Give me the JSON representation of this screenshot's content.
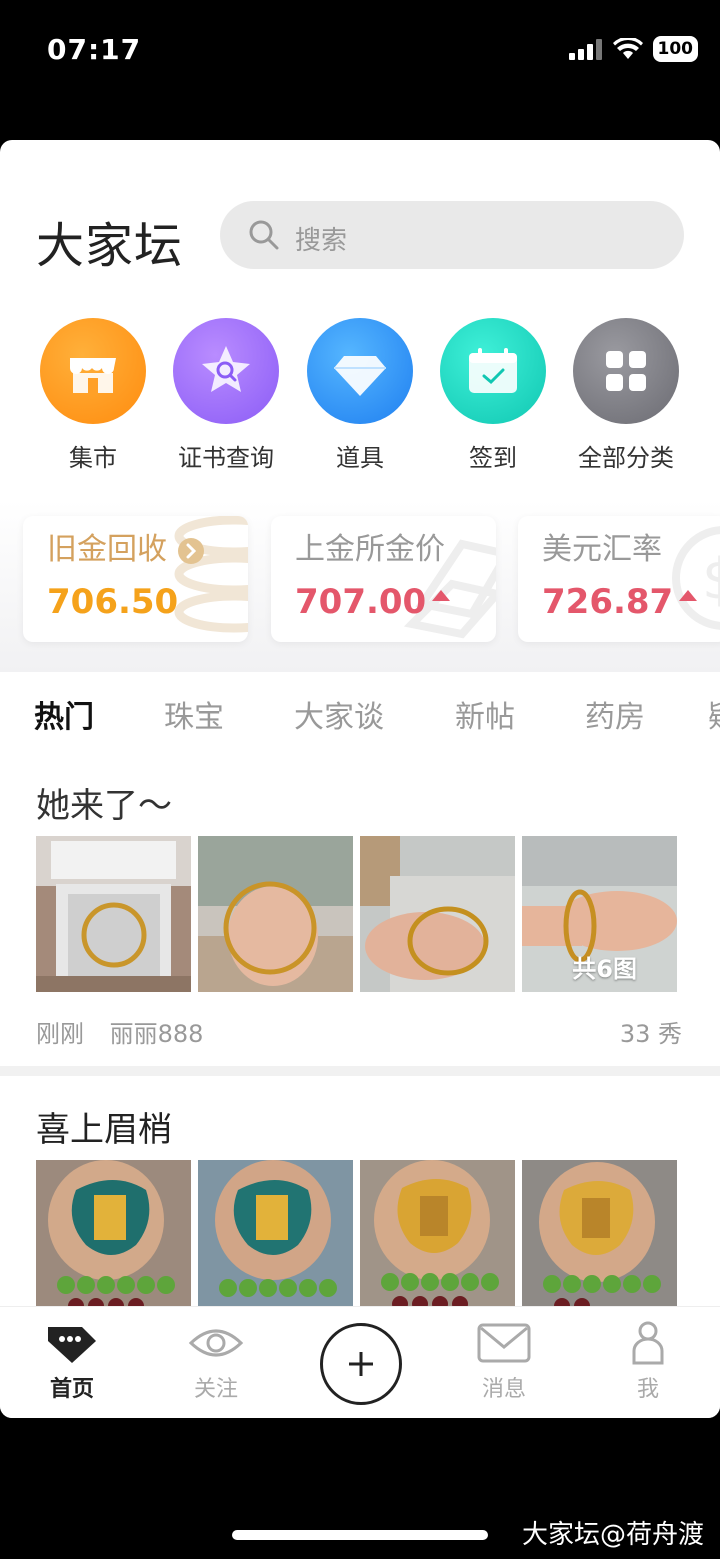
{
  "status": {
    "time": "07:17",
    "battery": "100"
  },
  "header": {
    "logo": "大家坛",
    "search_placeholder": "搜索"
  },
  "categories": [
    {
      "label": "集市",
      "icon": "market-icon"
    },
    {
      "label": "证书查询",
      "icon": "certificate-search-icon"
    },
    {
      "label": "道具",
      "icon": "diamond-icon"
    },
    {
      "label": "签到",
      "icon": "calendar-check-icon"
    },
    {
      "label": "全部分类",
      "icon": "grid-icon"
    }
  ],
  "prices": [
    {
      "title": "旧金回收",
      "value": "706.50",
      "color": "#f5a21b"
    },
    {
      "title": "上金所金价",
      "value": "707.00",
      "color": "#e4576b"
    },
    {
      "title": "美元汇率",
      "value": "726.87",
      "color": "#e4576b"
    }
  ],
  "tabs": [
    "热门",
    "珠宝",
    "大家谈",
    "新帖",
    "药房",
    "疑"
  ],
  "posts": [
    {
      "title": "她来了～",
      "time": "刚刚",
      "author": "丽丽888",
      "stat": "33 秀",
      "photo_count": "共6图"
    },
    {
      "title": "喜上眉梢"
    }
  ],
  "nav": [
    {
      "label": "首页",
      "icon": "home-icon"
    },
    {
      "label": "关注",
      "icon": "eye-icon"
    },
    {
      "label": "",
      "icon": "plus-icon"
    },
    {
      "label": "消息",
      "icon": "mail-icon"
    },
    {
      "label": "我",
      "icon": "user-icon"
    }
  ],
  "watermark": "大家坛@荷舟渡"
}
